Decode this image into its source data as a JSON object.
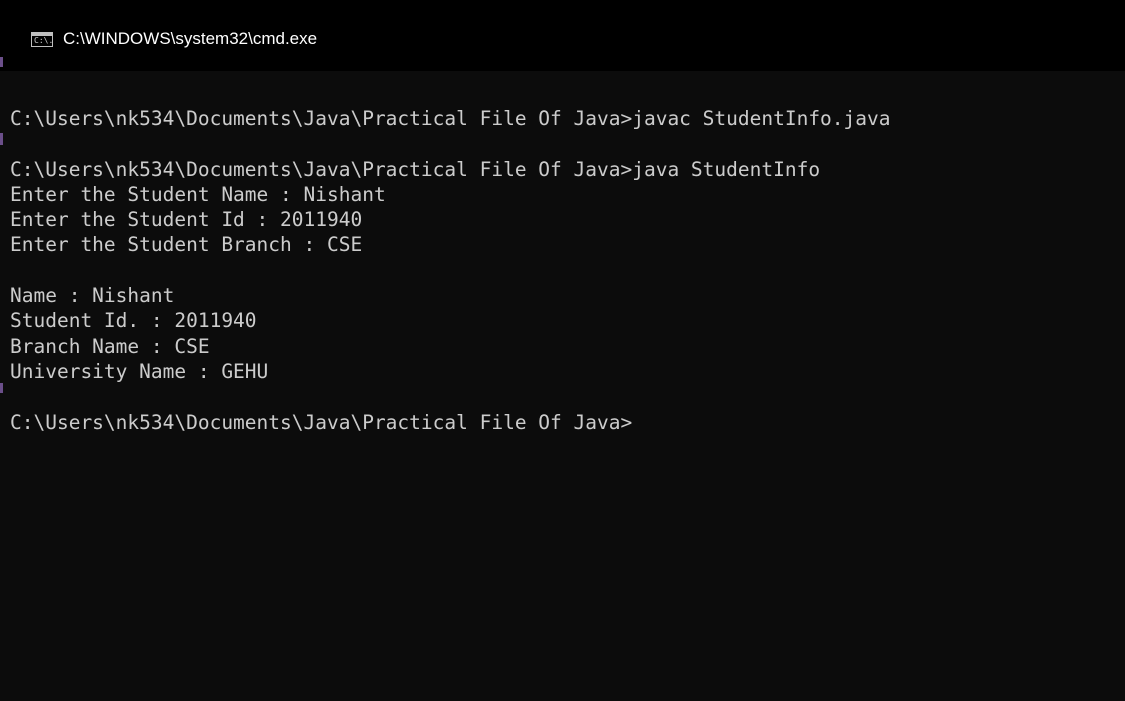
{
  "window": {
    "title": "C:\\WINDOWS\\system32\\cmd.exe",
    "icon": "cmd-console-icon",
    "icon_glyph": "C:\\."
  },
  "colors": {
    "titlebar_bg": "#000000",
    "console_bg": "#0c0c0c",
    "console_text": "#cccccc",
    "title_text": "#ffffff"
  },
  "console": {
    "lines": [
      "C:\\Users\\nk534\\Documents\\Java\\Practical File Of Java>javac StudentInfo.java",
      "",
      "C:\\Users\\nk534\\Documents\\Java\\Practical File Of Java>java StudentInfo",
      "Enter the Student Name : Nishant",
      "Enter the Student Id : 2011940",
      "Enter the Student Branch : CSE",
      "",
      "Name : Nishant",
      "Student Id. : 2011940",
      "Branch Name : CSE",
      "University Name : GEHU",
      "",
      "C:\\Users\\nk534\\Documents\\Java\\Practical File Of Java>"
    ]
  }
}
